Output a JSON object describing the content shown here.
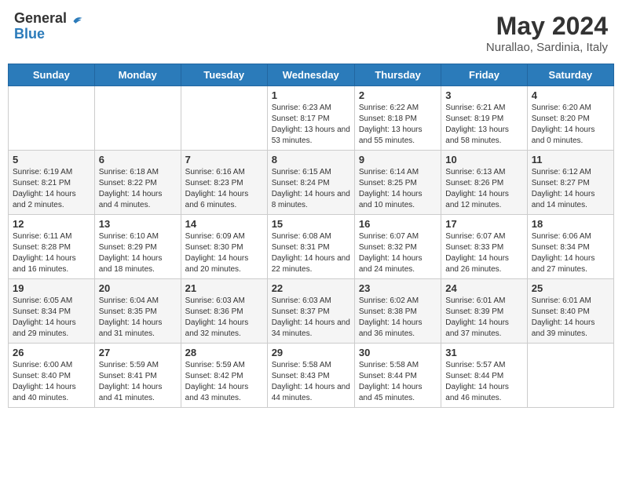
{
  "header": {
    "logo_general": "General",
    "logo_blue": "Blue",
    "month_title": "May 2024",
    "subtitle": "Nurallao, Sardinia, Italy"
  },
  "weekdays": [
    "Sunday",
    "Monday",
    "Tuesday",
    "Wednesday",
    "Thursday",
    "Friday",
    "Saturday"
  ],
  "weeks": [
    [
      {
        "day": "",
        "sunrise": "",
        "sunset": "",
        "daylight": ""
      },
      {
        "day": "",
        "sunrise": "",
        "sunset": "",
        "daylight": ""
      },
      {
        "day": "",
        "sunrise": "",
        "sunset": "",
        "daylight": ""
      },
      {
        "day": "1",
        "sunrise": "Sunrise: 6:23 AM",
        "sunset": "Sunset: 8:17 PM",
        "daylight": "Daylight: 13 hours and 53 minutes."
      },
      {
        "day": "2",
        "sunrise": "Sunrise: 6:22 AM",
        "sunset": "Sunset: 8:18 PM",
        "daylight": "Daylight: 13 hours and 55 minutes."
      },
      {
        "day": "3",
        "sunrise": "Sunrise: 6:21 AM",
        "sunset": "Sunset: 8:19 PM",
        "daylight": "Daylight: 13 hours and 58 minutes."
      },
      {
        "day": "4",
        "sunrise": "Sunrise: 6:20 AM",
        "sunset": "Sunset: 8:20 PM",
        "daylight": "Daylight: 14 hours and 0 minutes."
      }
    ],
    [
      {
        "day": "5",
        "sunrise": "Sunrise: 6:19 AM",
        "sunset": "Sunset: 8:21 PM",
        "daylight": "Daylight: 14 hours and 2 minutes."
      },
      {
        "day": "6",
        "sunrise": "Sunrise: 6:18 AM",
        "sunset": "Sunset: 8:22 PM",
        "daylight": "Daylight: 14 hours and 4 minutes."
      },
      {
        "day": "7",
        "sunrise": "Sunrise: 6:16 AM",
        "sunset": "Sunset: 8:23 PM",
        "daylight": "Daylight: 14 hours and 6 minutes."
      },
      {
        "day": "8",
        "sunrise": "Sunrise: 6:15 AM",
        "sunset": "Sunset: 8:24 PM",
        "daylight": "Daylight: 14 hours and 8 minutes."
      },
      {
        "day": "9",
        "sunrise": "Sunrise: 6:14 AM",
        "sunset": "Sunset: 8:25 PM",
        "daylight": "Daylight: 14 hours and 10 minutes."
      },
      {
        "day": "10",
        "sunrise": "Sunrise: 6:13 AM",
        "sunset": "Sunset: 8:26 PM",
        "daylight": "Daylight: 14 hours and 12 minutes."
      },
      {
        "day": "11",
        "sunrise": "Sunrise: 6:12 AM",
        "sunset": "Sunset: 8:27 PM",
        "daylight": "Daylight: 14 hours and 14 minutes."
      }
    ],
    [
      {
        "day": "12",
        "sunrise": "Sunrise: 6:11 AM",
        "sunset": "Sunset: 8:28 PM",
        "daylight": "Daylight: 14 hours and 16 minutes."
      },
      {
        "day": "13",
        "sunrise": "Sunrise: 6:10 AM",
        "sunset": "Sunset: 8:29 PM",
        "daylight": "Daylight: 14 hours and 18 minutes."
      },
      {
        "day": "14",
        "sunrise": "Sunrise: 6:09 AM",
        "sunset": "Sunset: 8:30 PM",
        "daylight": "Daylight: 14 hours and 20 minutes."
      },
      {
        "day": "15",
        "sunrise": "Sunrise: 6:08 AM",
        "sunset": "Sunset: 8:31 PM",
        "daylight": "Daylight: 14 hours and 22 minutes."
      },
      {
        "day": "16",
        "sunrise": "Sunrise: 6:07 AM",
        "sunset": "Sunset: 8:32 PM",
        "daylight": "Daylight: 14 hours and 24 minutes."
      },
      {
        "day": "17",
        "sunrise": "Sunrise: 6:07 AM",
        "sunset": "Sunset: 8:33 PM",
        "daylight": "Daylight: 14 hours and 26 minutes."
      },
      {
        "day": "18",
        "sunrise": "Sunrise: 6:06 AM",
        "sunset": "Sunset: 8:34 PM",
        "daylight": "Daylight: 14 hours and 27 minutes."
      }
    ],
    [
      {
        "day": "19",
        "sunrise": "Sunrise: 6:05 AM",
        "sunset": "Sunset: 8:34 PM",
        "daylight": "Daylight: 14 hours and 29 minutes."
      },
      {
        "day": "20",
        "sunrise": "Sunrise: 6:04 AM",
        "sunset": "Sunset: 8:35 PM",
        "daylight": "Daylight: 14 hours and 31 minutes."
      },
      {
        "day": "21",
        "sunrise": "Sunrise: 6:03 AM",
        "sunset": "Sunset: 8:36 PM",
        "daylight": "Daylight: 14 hours and 32 minutes."
      },
      {
        "day": "22",
        "sunrise": "Sunrise: 6:03 AM",
        "sunset": "Sunset: 8:37 PM",
        "daylight": "Daylight: 14 hours and 34 minutes."
      },
      {
        "day": "23",
        "sunrise": "Sunrise: 6:02 AM",
        "sunset": "Sunset: 8:38 PM",
        "daylight": "Daylight: 14 hours and 36 minutes."
      },
      {
        "day": "24",
        "sunrise": "Sunrise: 6:01 AM",
        "sunset": "Sunset: 8:39 PM",
        "daylight": "Daylight: 14 hours and 37 minutes."
      },
      {
        "day": "25",
        "sunrise": "Sunrise: 6:01 AM",
        "sunset": "Sunset: 8:40 PM",
        "daylight": "Daylight: 14 hours and 39 minutes."
      }
    ],
    [
      {
        "day": "26",
        "sunrise": "Sunrise: 6:00 AM",
        "sunset": "Sunset: 8:40 PM",
        "daylight": "Daylight: 14 hours and 40 minutes."
      },
      {
        "day": "27",
        "sunrise": "Sunrise: 5:59 AM",
        "sunset": "Sunset: 8:41 PM",
        "daylight": "Daylight: 14 hours and 41 minutes."
      },
      {
        "day": "28",
        "sunrise": "Sunrise: 5:59 AM",
        "sunset": "Sunset: 8:42 PM",
        "daylight": "Daylight: 14 hours and 43 minutes."
      },
      {
        "day": "29",
        "sunrise": "Sunrise: 5:58 AM",
        "sunset": "Sunset: 8:43 PM",
        "daylight": "Daylight: 14 hours and 44 minutes."
      },
      {
        "day": "30",
        "sunrise": "Sunrise: 5:58 AM",
        "sunset": "Sunset: 8:44 PM",
        "daylight": "Daylight: 14 hours and 45 minutes."
      },
      {
        "day": "31",
        "sunrise": "Sunrise: 5:57 AM",
        "sunset": "Sunset: 8:44 PM",
        "daylight": "Daylight: 14 hours and 46 minutes."
      },
      {
        "day": "",
        "sunrise": "",
        "sunset": "",
        "daylight": ""
      }
    ]
  ]
}
